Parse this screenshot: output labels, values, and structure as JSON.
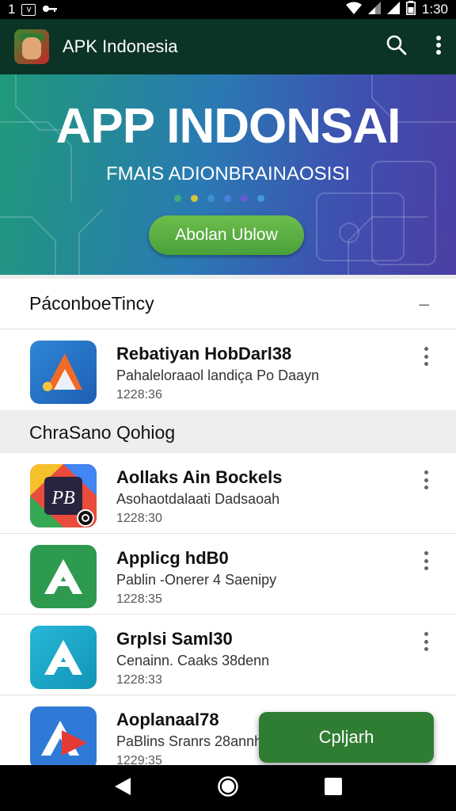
{
  "status_bar": {
    "left_number": "1",
    "left_badge": "v",
    "time": "1:30"
  },
  "app_bar": {
    "title": "APK Indonesia",
    "icons": [
      "search-icon",
      "more-vert-icon"
    ]
  },
  "hero": {
    "title": "APP INDONSAI",
    "subtitle": "FMAIS ADIONBRAINAOSISI",
    "button_label": "Abolan Ublow",
    "dot_colors": [
      "#3fae7a",
      "#d6c33a",
      "#3f8fd0",
      "#4b7fe0",
      "#6a5ad0",
      "#3e9ad8"
    ]
  },
  "section1": {
    "title": "PáconboeTincy",
    "collapse_symbol": "–",
    "items": [
      {
        "name": "Rebatiyan HobDarl38",
        "desc": "Pahaleloraaol landiça Po Daayn",
        "size": "1228:36"
      }
    ]
  },
  "section2": {
    "title": "ChraSano Qohiog",
    "items": [
      {
        "name": "Aollaks Ain Bockels",
        "desc": "Asohaotdalaati Dadsaoah",
        "size": "1228:30"
      },
      {
        "name": "Applicg hdB0",
        "desc": "Pablin -Onerer 4 Saenipy",
        "size": "1228:35"
      },
      {
        "name": "Grplsi Saml30",
        "desc": "Cenainn. Caaks 38denn",
        "size": "1228:33"
      },
      {
        "name": "Aoplanaal78",
        "desc": "PaBlins Sranrs 28annha",
        "size": "1229:35"
      }
    ]
  },
  "fab": {
    "label": "Cpljarh"
  },
  "colors": {
    "app_bar": "#0b3326",
    "accent_green": "#2f7d32"
  }
}
